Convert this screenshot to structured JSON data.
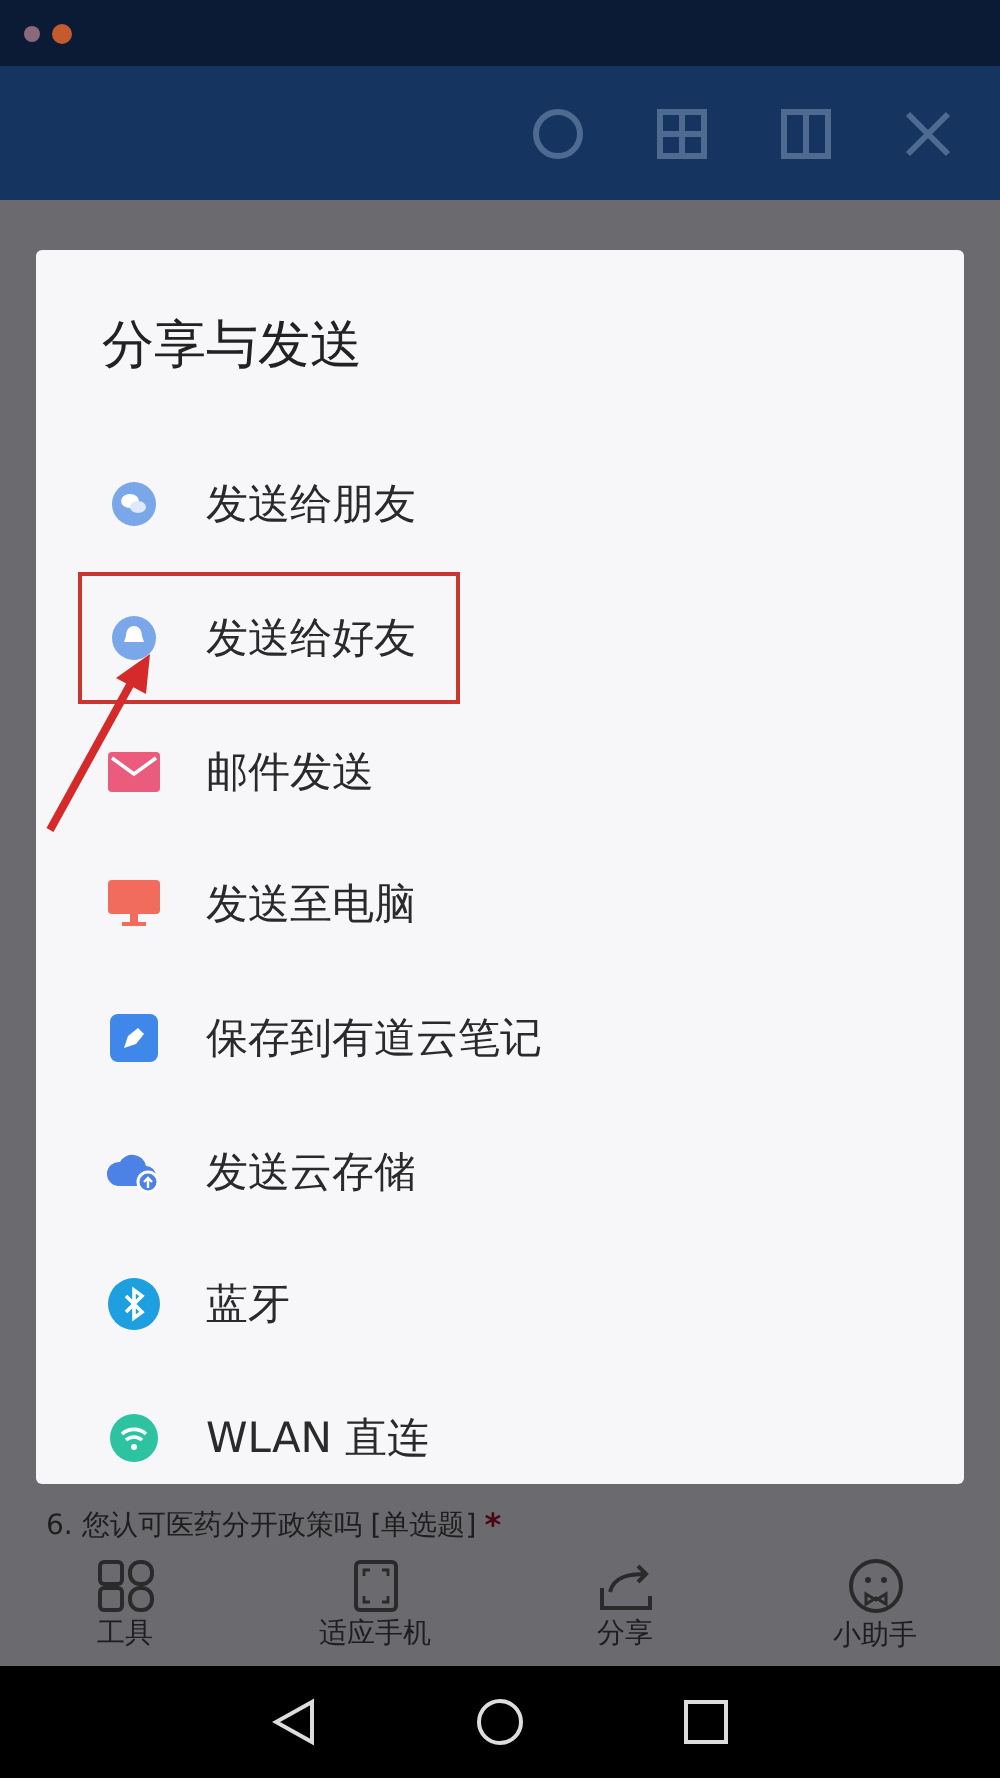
{
  "share_dialog": {
    "title": "分享与发送",
    "items": [
      {
        "kind": "wechat",
        "label": "发送给朋友",
        "highlighted": false
      },
      {
        "kind": "qq",
        "label": "发送给好友",
        "highlighted": true
      },
      {
        "kind": "mail",
        "label": "邮件发送",
        "highlighted": false
      },
      {
        "kind": "computer",
        "label": "发送至电脑",
        "highlighted": false
      },
      {
        "kind": "note",
        "label": "保存到有道云笔记",
        "highlighted": false
      },
      {
        "kind": "cloud",
        "label": "发送云存储",
        "highlighted": false
      },
      {
        "kind": "bluetooth",
        "label": "蓝牙",
        "highlighted": false
      },
      {
        "kind": "wifi",
        "label": "WLAN 直连",
        "highlighted": false
      }
    ]
  },
  "background_question": {
    "text": "6. 您认可医药分开政策吗 [单选题]",
    "required_mark": "*"
  },
  "toolbar": [
    {
      "kind": "tools",
      "label": "工具"
    },
    {
      "kind": "fit",
      "label": "适应手机"
    },
    {
      "kind": "share",
      "label": "分享"
    },
    {
      "kind": "assistant",
      "label": "小助手"
    }
  ]
}
